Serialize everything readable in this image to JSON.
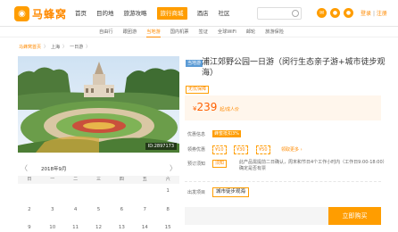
{
  "nav": {
    "logo_text": "马蜂窝",
    "logo_glyph": "◉",
    "links": [
      "首页",
      "目的地",
      "旅游攻略",
      "去旅行",
      "酒店",
      "社区"
    ],
    "travel_label": "旅行商城",
    "auth": {
      "login": "登录",
      "sep": "|",
      "register": "注册"
    },
    "brand_color": "#ff9d00"
  },
  "subnav": {
    "items": [
      "自由行",
      "跟团游",
      "当地游",
      "国内机票",
      "签证",
      "全球WiFi",
      "邮轮",
      "旅游保险"
    ],
    "active_index": 2
  },
  "breadcrumb": {
    "home": "马蜂窝首页",
    "items": [
      "上海",
      "一日游"
    ]
  },
  "photo": {
    "id_label": "ID:2897173"
  },
  "calendar": {
    "prev": "〈",
    "next": "〉",
    "month": "2018年9月",
    "weekdays": [
      "日",
      "一",
      "二",
      "三",
      "四",
      "五",
      "六"
    ],
    "weeks": [
      [
        "",
        "",
        "",
        "",
        "",
        "",
        "1"
      ],
      [
        "2",
        "3",
        "4",
        "5",
        "6",
        "7",
        "8"
      ],
      [
        "9",
        "10",
        "11",
        "12",
        "13",
        "14",
        "15"
      ]
    ]
  },
  "product": {
    "tag": "当地游",
    "title": "浦江郊野公园一日游（闵行生态亲子游+城市徒步观海）",
    "badge": "无忧保障",
    "price_currency": "¥",
    "price_value": "239",
    "price_suffix": "起/成人价",
    "labels": {
      "promo": "优惠信息",
      "coupon": "领券优惠",
      "booking": "预订须知",
      "options": "出发项目"
    },
    "promo_tag": "蜂蜜抵扣3%",
    "coupons": [
      "¥10",
      "¥30",
      "¥50"
    ],
    "coupon_more": "领取更多 ›",
    "booking_tag": "须知",
    "booking_text": "此产品需提前二日确认，周末和节日4个工作小时内（工作日9:00-18:00）确定是否有票",
    "option_label": "城市徒步观海",
    "buy_label": "立即购买"
  }
}
